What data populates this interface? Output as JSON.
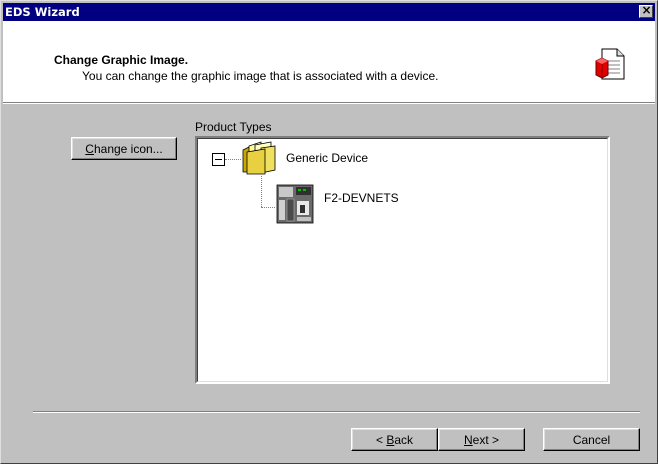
{
  "window": {
    "title": "EDS Wizard",
    "close_glyph": "×"
  },
  "header": {
    "title": "Change Graphic Image.",
    "subtitle": "You can change the graphic image that is associated with a device.",
    "icon": "document-icon"
  },
  "buttons": {
    "change_icon": {
      "prefix": "",
      "access": "C",
      "rest": "hange icon..."
    },
    "back": {
      "prefix": "< ",
      "access": "B",
      "rest": "ack"
    },
    "next": {
      "prefix": "",
      "access": "N",
      "rest": "ext >"
    },
    "cancel": "Cancel"
  },
  "tree": {
    "label": "Product Types",
    "root": {
      "label": "Generic Device",
      "icon": "folder-icon",
      "expanded": true
    },
    "children": [
      {
        "label": "F2-DEVNETS",
        "icon": "device-module-icon"
      }
    ]
  }
}
